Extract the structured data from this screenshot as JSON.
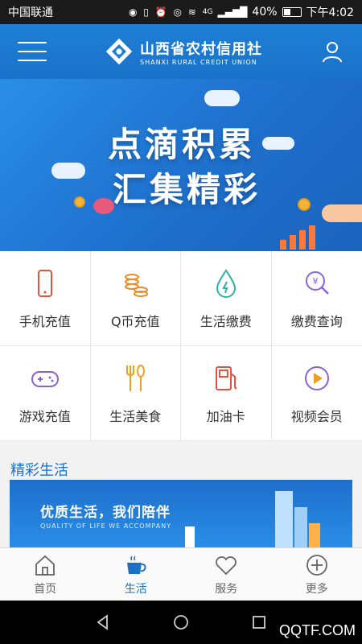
{
  "status_bar": {
    "carrier": "中国联通",
    "signal_tag": "4G",
    "battery": "40%",
    "time": "下午4:02"
  },
  "header": {
    "title_cn": "山西省农村信用社",
    "title_en": "SHANXI RURAL CREDIT UNION"
  },
  "banner": {
    "line1": "点滴积累",
    "line2": "汇集精彩"
  },
  "services": [
    {
      "label": "手机充值",
      "icon": "phone-icon",
      "color": "#e5533d"
    },
    {
      "label": "Q币充值",
      "icon": "coins-icon",
      "color": "#f08a24"
    },
    {
      "label": "生活缴费",
      "icon": "water-drop-icon",
      "color": "#2bb3a3"
    },
    {
      "label": "缴费查询",
      "icon": "search-yuan-icon",
      "color": "#8a63d2"
    },
    {
      "label": "游戏充值",
      "icon": "gamepad-icon",
      "color": "#8a63d2"
    },
    {
      "label": "生活美食",
      "icon": "fork-spoon-icon",
      "color": "#f0a020"
    },
    {
      "label": "加油卡",
      "icon": "fuel-icon",
      "color": "#e5533d"
    },
    {
      "label": "视频会员",
      "icon": "play-icon",
      "color": "#8a63d2"
    }
  ],
  "section": {
    "title": "精彩生活"
  },
  "promo": {
    "title": "优质生活，我们陪伴",
    "subtitle": "QUALITY OF LIFE WE ACCOMPANY"
  },
  "tabs": [
    {
      "label": "首页",
      "icon": "home-icon"
    },
    {
      "label": "生活",
      "icon": "coffee-icon",
      "active": true
    },
    {
      "label": "服务",
      "icon": "heart-icon"
    },
    {
      "label": "更多",
      "icon": "plus-circle-icon"
    }
  ],
  "watermark": "QQTF.COM",
  "colors": {
    "primary": "#1a72c8",
    "header": "#1e7fd6"
  }
}
